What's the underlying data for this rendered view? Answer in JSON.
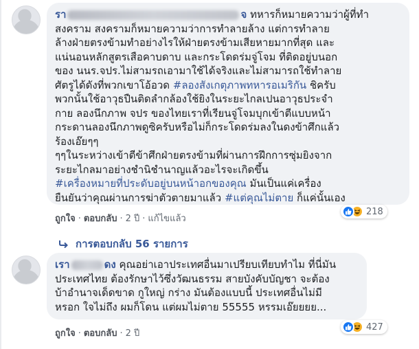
{
  "comment1": {
    "author_visible": "รา",
    "author_suffix": "จ",
    "text": "ทหารก็หมายความว่าผู้ที่ทำ\nสงคราม สงครามก็หมายความว่าการทำลายล้าง แต่การทำลาย\nล้างฝ่ายตรงข้ามทำอย่างไรให้ฝ่ายตรงข้ามเสียหายมากที่สุด และ\nแน่นอนหลักสูตรเสือคาบดาบ และกระโดดร่มจู่โจม ที่ติดอยู่บนอก\nของ นนร.จปร.ไม่สามรถเอามาใช้ได้จริงและไม่สามารถใช้ทำลาย\nศัตรูได้ดังที่พวกเขาโอ้อวด ",
    "hashtag1": "#ลองสังเกตุภาพทหารอเมริกัน",
    "text2": " ชิครับ\nพวกนั้นใช้อาวุธปืนติดลำกล้องใช้ยิงในระยะไกลเปนอาวุธประจำ\nกาย ลองนึกภาพ จปร ของไทยเราที่เรียนจู่โจมบุกเข้าตีแบบหน้า\nกระดานลองนึกภาพดูซิครับหรือไม่ก็กระโดดร่มลงในดงข้าศึกแล้ว\nร้องเอ๊ยๆๆ\nๆๆในระหว่างเข้าตีข้าศึกฝ่ายตรงข้ามที่ผ่านการฝึกการซุ่มยิงจาก\nระยะไกลมาอย่างชำนิชำนาญแล้วอะไรจะเกิดขึ้น\n",
    "hashtag2": "#เครื่องหมายที่ประดับอยู่บนหน้าอกของคุณ",
    "text3": " มันเป็นแค่เครื่อง\nยืนยันว่าคุณผ่านการฆ่าตัวตายมาแล้ว ",
    "hashtag3": "#แต่คุณไม่ตาย",
    "text4": " ก็แค่นั้นเอง",
    "actions": {
      "like": "ถูกใจ",
      "reply": "ตอบกลับ",
      "time": "2 ปี",
      "edited": "แก้ไขแล้ว",
      "separator": "·"
    },
    "reactions": {
      "icons": [
        "like-icon",
        "haha-icon"
      ],
      "count": "218"
    },
    "view_replies": "การตอบกลับ 56 รายการ"
  },
  "comment2": {
    "author_visible": "เรา",
    "author_suffix": "ดง",
    "text": "คุณอย่าเอาประเทศอื่นมาเปรียบเทียบทำไม ที่นี่มัน\nประเทศไทย ต้องรักษาไว้ซึ่งวัฒนธรรม สายบังคับบัญชา จะต้อง\nบ้าอำนาจเด็ดขาด กูใหญ่ กร่าง มันต้องแบบนี้ ประเทศอื่นไม่มี\nหรอก ใจไม่ถึง ผมก็โดน แต่ผมไม่ตาย 55555 หรรมเอ๊ยยยย...",
    "actions": {
      "like": "ถูกใจ",
      "reply": "ตอบกลับ",
      "time": "2 ปี",
      "separator": "·"
    },
    "reactions": {
      "icons": [
        "like-icon",
        "haha-icon"
      ],
      "count": "427"
    }
  },
  "colors": {
    "bubble": "#f0f2f5",
    "link": "#385898",
    "like_blue": "#1877f2",
    "haha_yellow": "#f7b125",
    "meta": "#606770"
  }
}
